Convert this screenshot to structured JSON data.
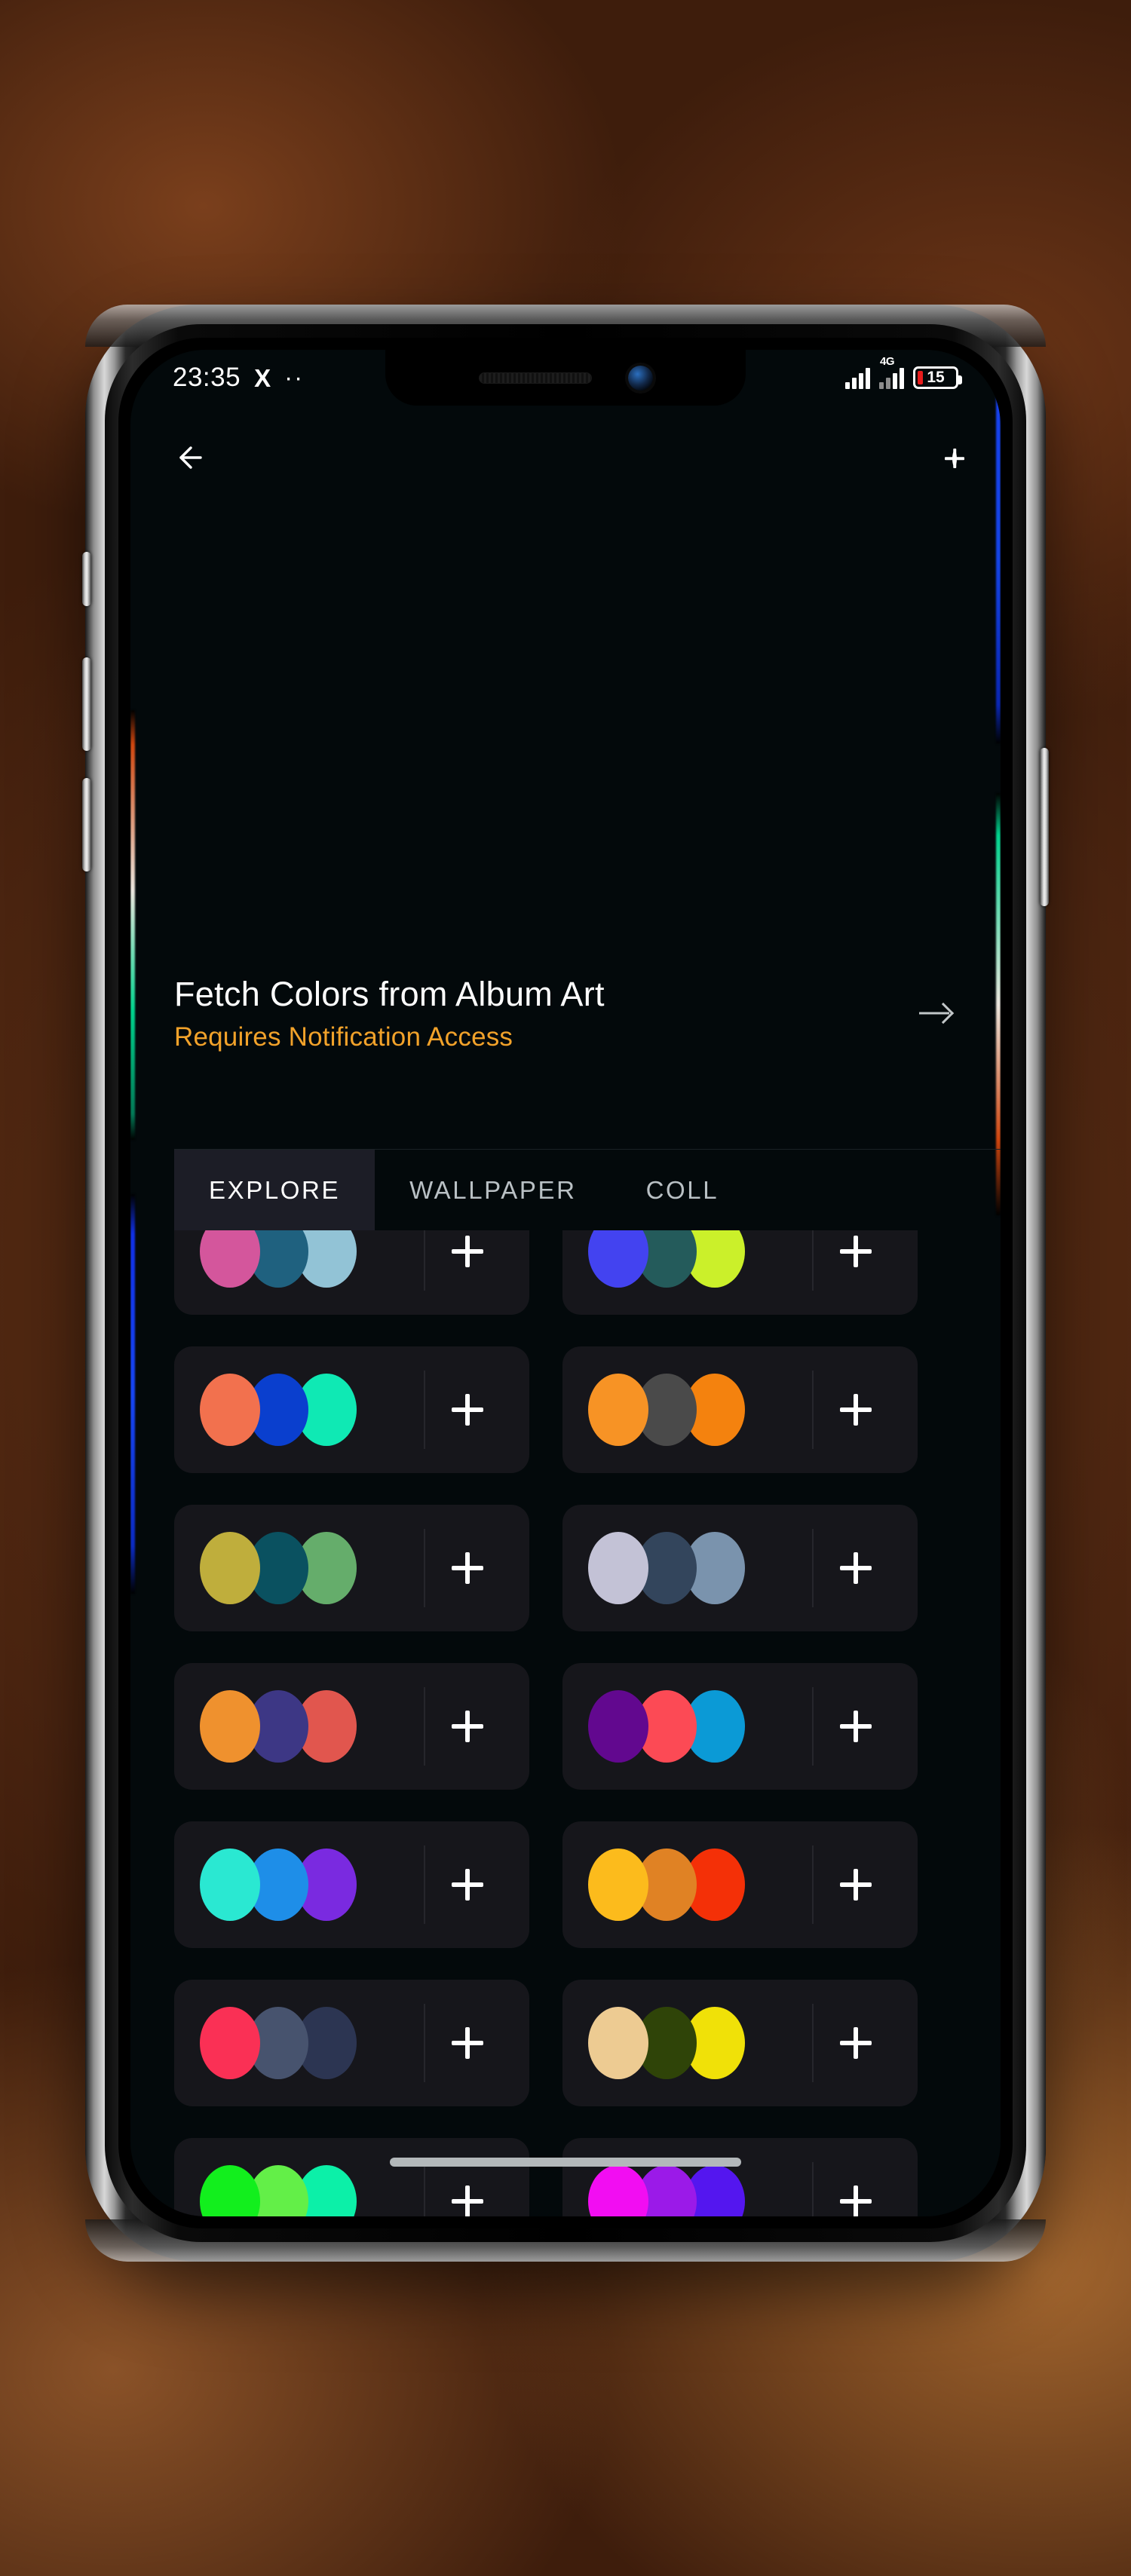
{
  "status_bar": {
    "time": "23:35",
    "app_icon": "X",
    "more_dots": "··",
    "network_type": "4G",
    "battery_percent": "15"
  },
  "app_bar": {
    "back_label": "back-arrow",
    "add_label": "add"
  },
  "header": {
    "title": "Fetch Colors from Album Art",
    "subtitle": "Requires Notification Access",
    "chevron": "forward-arrow"
  },
  "tabs": [
    {
      "label": "EXPLORE",
      "active": true
    },
    {
      "label": "WALLPAPER",
      "active": false
    },
    {
      "label": "COLL",
      "active": false
    }
  ],
  "add_button_label": "+",
  "palettes": [
    {
      "colors": [
        "#d4569c",
        "#1f617f",
        "#92c3d6"
      ]
    },
    {
      "colors": [
        "#4343f0",
        "#245b5b",
        "#cbf02a"
      ]
    },
    {
      "colors": [
        "#f2714e",
        "#0a3fce",
        "#0fe9b4"
      ]
    },
    {
      "colors": [
        "#f79325",
        "#4a4a4a",
        "#f4820e"
      ]
    },
    {
      "colors": [
        "#bfae3c",
        "#0a5160",
        "#65ad6b"
      ]
    },
    {
      "colors": [
        "#c3c2d6",
        "#33455c",
        "#7a93ad"
      ]
    },
    {
      "colors": [
        "#ef912e",
        "#3d3785",
        "#e1564e"
      ]
    },
    {
      "colors": [
        "#62088f",
        "#fc4a55",
        "#0b9ad6"
      ]
    },
    {
      "colors": [
        "#2ae8d2",
        "#1e8ee8",
        "#7a2ae0"
      ]
    },
    {
      "colors": [
        "#fcbb1c",
        "#e08224",
        "#f43007"
      ]
    },
    {
      "colors": [
        "#fa3055",
        "#47536e",
        "#2c3552"
      ]
    },
    {
      "colors": [
        "#edcb92",
        "#2f4408",
        "#f0e108"
      ]
    },
    {
      "colors": [
        "#12ef1d",
        "#63ef48",
        "#0cf0a8"
      ]
    },
    {
      "colors": [
        "#f20df2",
        "#9b1ae8",
        "#5416ef"
      ]
    },
    {
      "colors": [
        "#7a0718",
        "#b00c1d",
        "#f20b12"
      ]
    },
    {
      "colors": [
        "#1008f2",
        "#2b3ef2",
        "#0aa8f2"
      ]
    }
  ],
  "colors": {
    "accent_orange": "#f2a22a",
    "card_bg": "#16161b",
    "tab_active_bg": "#1c1d26",
    "screen_bg": "#03090b",
    "battery_red": "#e81c1c"
  }
}
